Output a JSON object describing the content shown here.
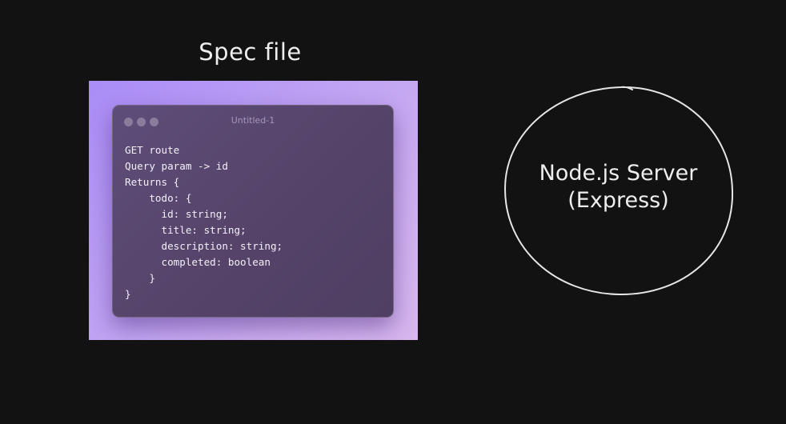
{
  "spec": {
    "caption": "Spec file",
    "window_title": "Untitled-1",
    "code_lines": [
      "GET route",
      "Query param -> id",
      "Returns {",
      "    todo: {",
      "      id: string;",
      "      title: string;",
      "      description: string;",
      "      completed: boolean",
      "    }",
      "}"
    ]
  },
  "server": {
    "line1": "Node.js Server",
    "line2": "(Express)"
  }
}
